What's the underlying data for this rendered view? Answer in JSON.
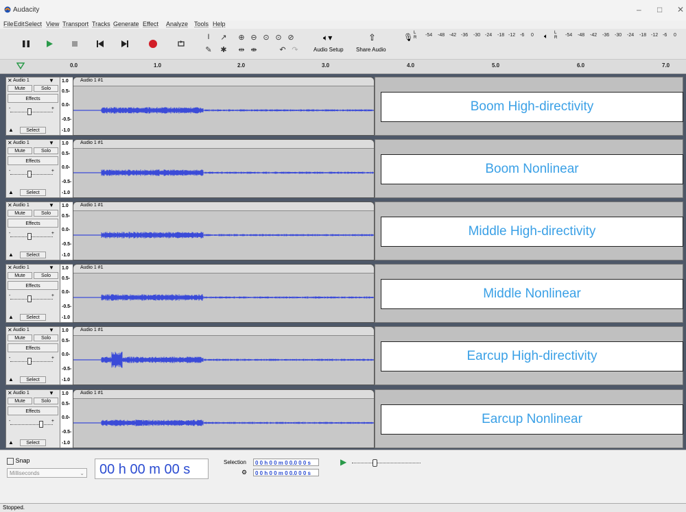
{
  "window": {
    "title": "Audacity",
    "minimize": "–",
    "maximize": "□",
    "close": "✕"
  },
  "menu": [
    "File",
    "Edit",
    "Select",
    "View",
    "Transport",
    "Tracks",
    "Generate",
    "Effect",
    "Analyze",
    "Tools",
    "Help"
  ],
  "toolbar": {
    "audio_setup_label": "Audio Setup",
    "share_audio_label": "Share Audio",
    "meter_scale": [
      "-54",
      "-48",
      "-42",
      "-36",
      "-30",
      "-24",
      "-18",
      "-12",
      "-6",
      "0"
    ],
    "meter_channels": [
      "L",
      "R"
    ]
  },
  "timeline": {
    "ticks": [
      "0.0",
      "1.0",
      "2.0",
      "3.0",
      "4.0",
      "5.0",
      "6.0",
      "7.0"
    ]
  },
  "tracks": [
    {
      "name": "Audio 1",
      "clip": "Audio 1 #1",
      "mute": "Mute",
      "solo": "Solo",
      "effects": "Effects",
      "select": "Select",
      "scale": [
        "1.0",
        "0.5-",
        "0.0-",
        "-0.5-",
        "-1.0"
      ],
      "overlay": "Boom High-directivity"
    },
    {
      "name": "Audio 1",
      "clip": "Audio 1 #1",
      "mute": "Mute",
      "solo": "Solo",
      "effects": "Effects",
      "select": "Select",
      "scale": [
        "1.0",
        "0.5-",
        "0.0-",
        "-0.5-",
        "-1.0"
      ],
      "overlay": "Boom Nonlinear"
    },
    {
      "name": "Audio 1",
      "clip": "Audio 1 #1",
      "mute": "Mute",
      "solo": "Solo",
      "effects": "Effects",
      "select": "Select",
      "scale": [
        "1.0",
        "0.5-",
        "0.0-",
        "-0.5-",
        "-1.0"
      ],
      "overlay": "Middle High-directivity"
    },
    {
      "name": "Audio 1",
      "clip": "Audio 1 #1",
      "mute": "Mute",
      "solo": "Solo",
      "effects": "Effects",
      "select": "Select",
      "scale": [
        "1.0",
        "0.5-",
        "0.0-",
        "-0.5-",
        "-1.0"
      ],
      "overlay": "Middle Nonlinear"
    },
    {
      "name": "Audio 1",
      "clip": "Audio 1 #1",
      "mute": "Mute",
      "solo": "Solo",
      "effects": "Effects",
      "select": "Select",
      "scale": [
        "1.0",
        "0.5-",
        "0.0-",
        "-0.5-",
        "-1.0"
      ],
      "overlay": "Earcup High-directivity"
    },
    {
      "name": "Audio 1",
      "clip": "Audio 1 #1",
      "mute": "Mute",
      "solo": "Solo",
      "effects": "Effects",
      "select": "Select",
      "scale": [
        "1.0",
        "0.5-",
        "0.0-",
        "-0.5-",
        "-1.0"
      ],
      "overlay": "Earcup Nonlinear"
    }
  ],
  "bottom": {
    "snap_label": "Snap",
    "snap_unit": "Milliseconds",
    "time_display": "00 h 00 m 00 s",
    "selection_label": "Selection",
    "selection_start": "0 0 h 0 0 m 0 0.0 0 0 s",
    "selection_end": "0 0 h 0 0 m 0 0.0 0 0 s"
  },
  "status": "Stopped.",
  "colors": {
    "waveform": "#3b4bd8",
    "overlay_text": "#3aa0e6",
    "record": "#d21e28",
    "play": "#2a9a4a",
    "track_bg": "#4e5868"
  }
}
